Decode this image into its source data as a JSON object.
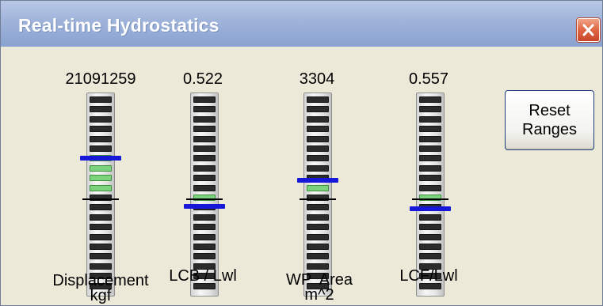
{
  "window": {
    "title": "Real-time Hydrostatics"
  },
  "gauges": [
    {
      "id": "displacement",
      "value": "21091259",
      "label_line1": "Displacement",
      "label_line2": "kgf",
      "marker_level": 0.68,
      "reference_level": 0.48
    },
    {
      "id": "lcb",
      "value": "0.522",
      "label_line1": "LCB / Lwl",
      "label_line2": "",
      "marker_level": 0.44,
      "reference_level": 0.48
    },
    {
      "id": "wp-area",
      "value": "3304",
      "label_line1": "WP  Area",
      "label_line2": "m^2",
      "marker_level": 0.57,
      "reference_level": 0.48
    },
    {
      "id": "lcf",
      "value": "0.557",
      "label_line1": "LCF/Lwl",
      "label_line2": "",
      "marker_level": 0.43,
      "reference_level": 0.48
    }
  ],
  "reset_button": {
    "line1": "Reset",
    "line2": "Ranges"
  },
  "colors": {
    "titlebar": "#9fb3da",
    "window_body": "#ece9d8",
    "marker_blue": "#1717d9",
    "led_off": "#2b2b2b",
    "led_on": "#7dd37d",
    "close_red": "#e06a48"
  },
  "icons": {
    "close": "close-icon"
  }
}
